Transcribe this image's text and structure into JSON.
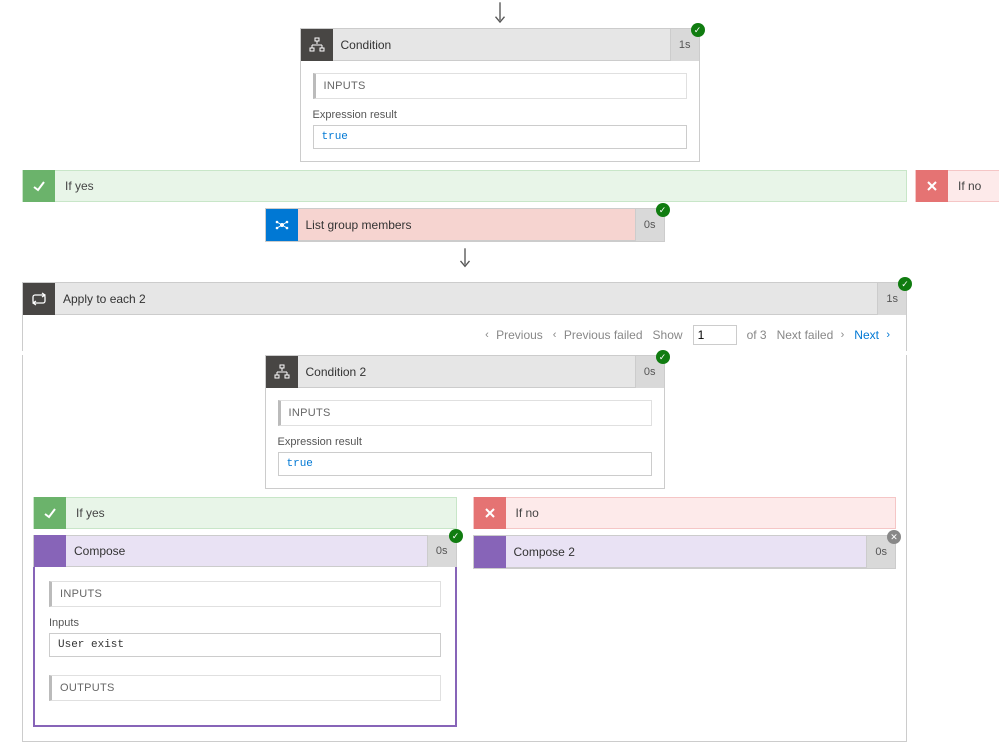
{
  "arrowGlyph": "↓",
  "condition1": {
    "title": "Condition",
    "duration": "1s",
    "inputsLabel": "INPUTS",
    "exprLabel": "Expression result",
    "exprValue": "true"
  },
  "outer": {
    "yesLabel": "If yes",
    "noLabel": "If no"
  },
  "listGroup": {
    "title": "List group members",
    "duration": "0s"
  },
  "applyEach": {
    "title": "Apply to each 2",
    "duration": "1s"
  },
  "pager": {
    "prev": "Previous",
    "prevFailed": "Previous failed",
    "showLabel": "Show",
    "current": "1",
    "ofText": "of 3",
    "nextFailed": "Next failed",
    "next": "Next"
  },
  "condition2": {
    "title": "Condition 2",
    "duration": "0s",
    "inputsLabel": "INPUTS",
    "exprLabel": "Expression result",
    "exprValue": "true"
  },
  "inner": {
    "yesLabel": "If yes",
    "noLabel": "If no"
  },
  "compose": {
    "title": "Compose",
    "duration": "0s",
    "inputsLabel": "INPUTS",
    "inputsField": "Inputs",
    "inputsValue": "User exist",
    "outputsLabel": "OUTPUTS"
  },
  "compose2": {
    "title": "Compose 2",
    "duration": "0s"
  }
}
